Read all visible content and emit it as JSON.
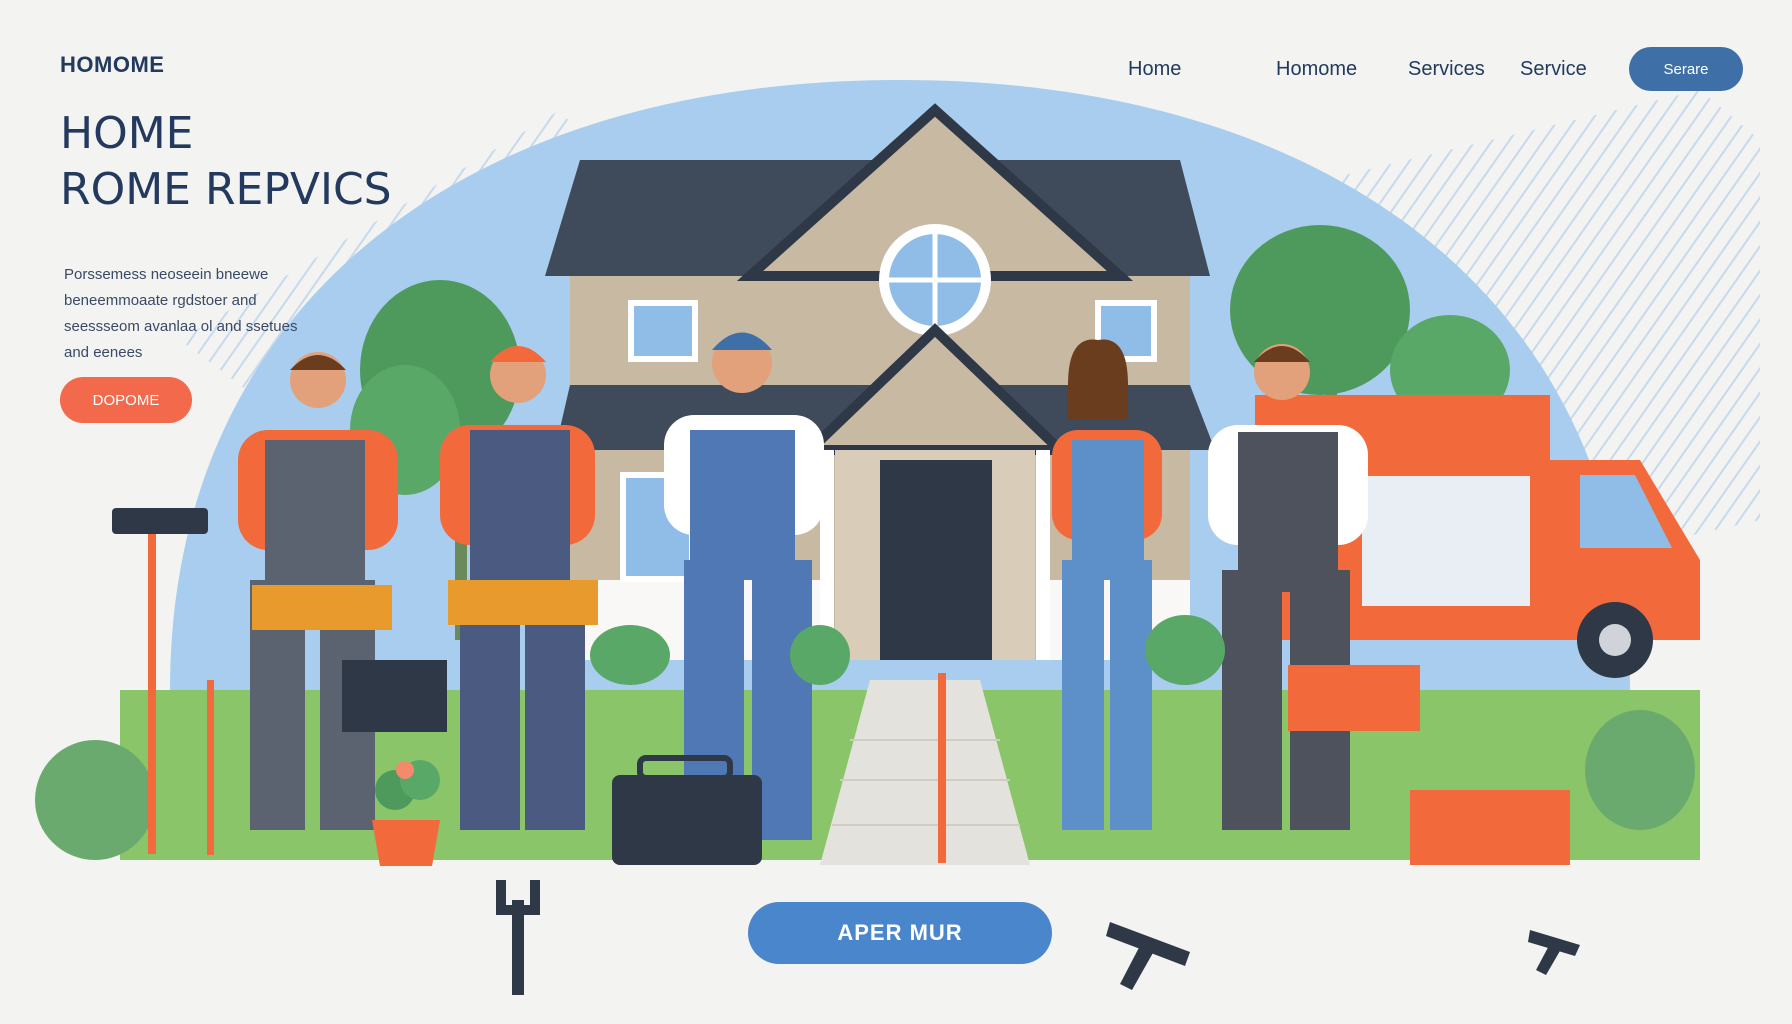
{
  "header": {
    "logo": "HOMOME",
    "nav": [
      "Home",
      "Homome",
      "Services",
      "Service"
    ],
    "cta_label": "Serare"
  },
  "hero": {
    "title_line1": "HOME",
    "title_line2": "ROME REPVICS",
    "description": "Porssemess neoseein bneewe beneemmoaate rgdstoer and seessseom avanlaa ol and ssetues and eenees",
    "cta_label": "DOPOME"
  },
  "footer": {
    "cta_label": "APER MUR"
  },
  "colors": {
    "navy": "#233a5e",
    "accent_blue": "#3e6fa6",
    "accent_orange": "#f26a4b",
    "sky": "#a9cdee",
    "grass": "#8bc56a"
  },
  "icons": [
    "house-illustration",
    "worker-figures",
    "moving-truck",
    "toolbox-icon",
    "wrench-icon",
    "hammer-icon"
  ]
}
